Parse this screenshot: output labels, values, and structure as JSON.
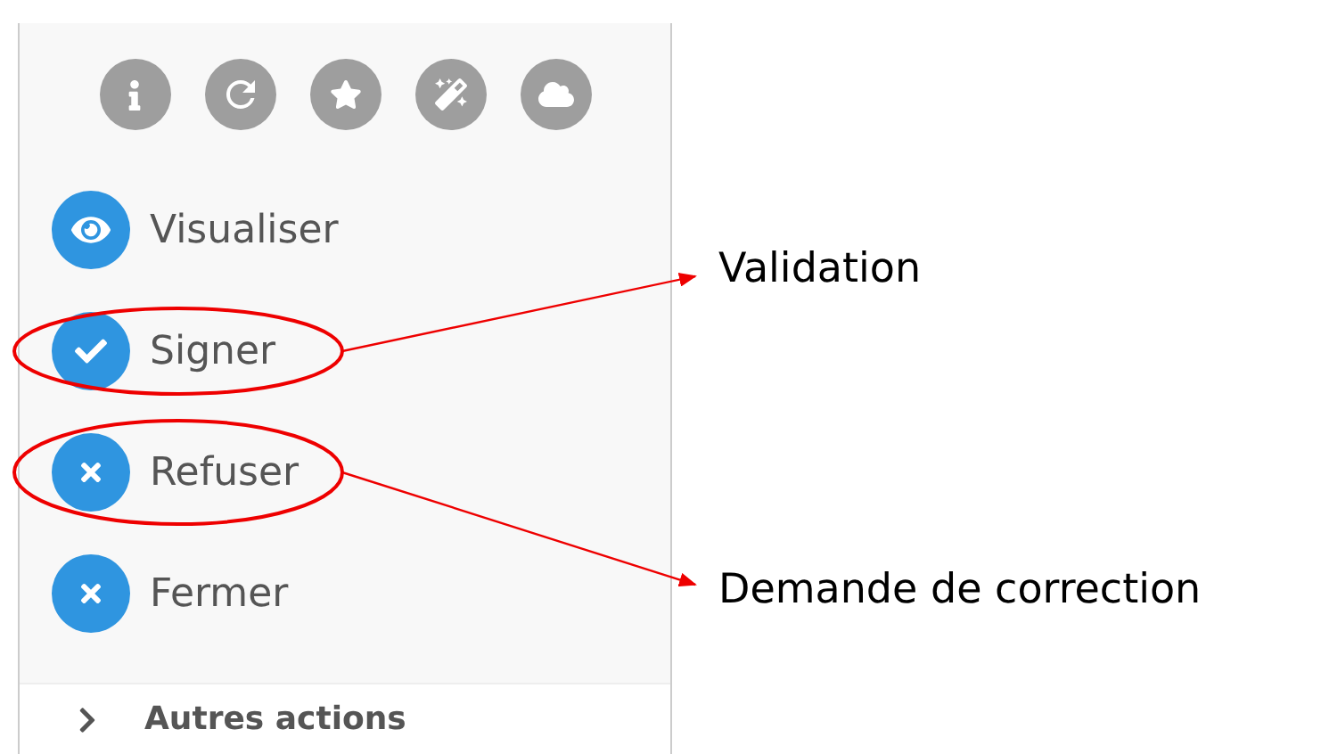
{
  "actions": [
    {
      "label": "Visualiser",
      "kind": "view"
    },
    {
      "label": "Signer",
      "kind": "sign",
      "annotation": "Validation"
    },
    {
      "label": "Refuser",
      "kind": "refuse",
      "annotation": "Demande de correction"
    },
    {
      "label": "Fermer",
      "kind": "close"
    }
  ],
  "more_actions": {
    "label": "Autres actions",
    "expanded": false
  }
}
